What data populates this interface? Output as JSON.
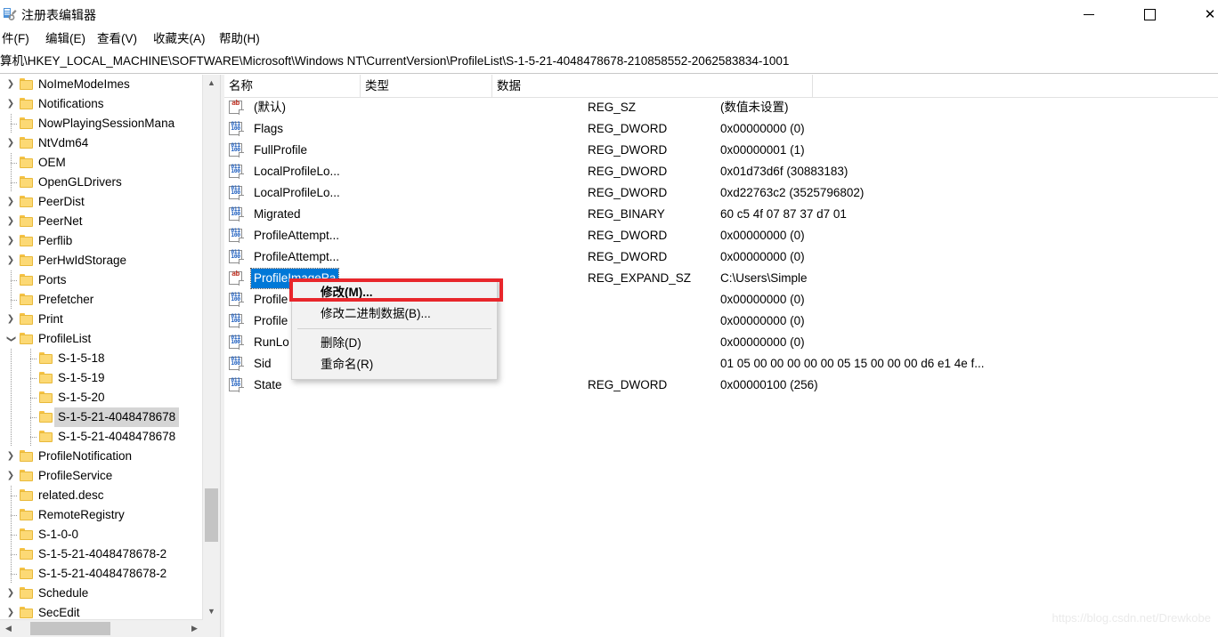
{
  "window": {
    "title": "注册表编辑器",
    "icon": "registry-editor-icon",
    "minimize_label": "—",
    "maximize_label": "□",
    "close_label": "✕"
  },
  "menubar": {
    "items": [
      {
        "label": "件(F)"
      },
      {
        "label": "编辑(E)"
      },
      {
        "label": "查看(V)"
      },
      {
        "label": "收藏夹(A)"
      },
      {
        "label": "帮助(H)"
      }
    ]
  },
  "address": {
    "path": "算机\\HKEY_LOCAL_MACHINE\\SOFTWARE\\Microsoft\\Windows NT\\CurrentVersion\\ProfileList\\S-1-5-21-4048478678-210858552-2062583834-1001"
  },
  "tree": {
    "items": [
      {
        "label": "NoImeModeImes",
        "indent": 0,
        "expander": "collapsed",
        "selected": false
      },
      {
        "label": "Notifications",
        "indent": 0,
        "expander": "collapsed",
        "selected": false
      },
      {
        "label": "NowPlayingSessionMana",
        "indent": 0,
        "expander": "leaf",
        "selected": false
      },
      {
        "label": "NtVdm64",
        "indent": 0,
        "expander": "collapsed",
        "selected": false
      },
      {
        "label": "OEM",
        "indent": 0,
        "expander": "leaf",
        "selected": false
      },
      {
        "label": "OpenGLDrivers",
        "indent": 0,
        "expander": "leaf",
        "selected": false
      },
      {
        "label": "PeerDist",
        "indent": 0,
        "expander": "collapsed",
        "selected": false
      },
      {
        "label": "PeerNet",
        "indent": 0,
        "expander": "collapsed",
        "selected": false
      },
      {
        "label": "Perflib",
        "indent": 0,
        "expander": "collapsed",
        "selected": false
      },
      {
        "label": "PerHwIdStorage",
        "indent": 0,
        "expander": "collapsed",
        "selected": false
      },
      {
        "label": "Ports",
        "indent": 0,
        "expander": "leaf",
        "selected": false
      },
      {
        "label": "Prefetcher",
        "indent": 0,
        "expander": "leaf",
        "selected": false
      },
      {
        "label": "Print",
        "indent": 0,
        "expander": "collapsed",
        "selected": false
      },
      {
        "label": "ProfileList",
        "indent": 0,
        "expander": "expanded",
        "selected": false
      },
      {
        "label": "S-1-5-18",
        "indent": 1,
        "expander": "leaf",
        "selected": false
      },
      {
        "label": "S-1-5-19",
        "indent": 1,
        "expander": "leaf",
        "selected": false
      },
      {
        "label": "S-1-5-20",
        "indent": 1,
        "expander": "leaf",
        "selected": false
      },
      {
        "label": "S-1-5-21-4048478678",
        "indent": 1,
        "expander": "leaf",
        "selected": true
      },
      {
        "label": "S-1-5-21-4048478678",
        "indent": 1,
        "expander": "leaf",
        "selected": false
      },
      {
        "label": "ProfileNotification",
        "indent": 0,
        "expander": "collapsed",
        "selected": false
      },
      {
        "label": "ProfileService",
        "indent": 0,
        "expander": "collapsed",
        "selected": false
      },
      {
        "label": "related.desc",
        "indent": 0,
        "expander": "leaf",
        "selected": false
      },
      {
        "label": "RemoteRegistry",
        "indent": 0,
        "expander": "leaf",
        "selected": false
      },
      {
        "label": "S-1-0-0",
        "indent": 0,
        "expander": "leaf",
        "selected": false
      },
      {
        "label": "S-1-5-21-4048478678-2",
        "indent": 0,
        "expander": "leaf",
        "selected": false
      },
      {
        "label": "S-1-5-21-4048478678-2",
        "indent": 0,
        "expander": "leaf",
        "selected": false
      },
      {
        "label": "Schedule",
        "indent": 0,
        "expander": "collapsed",
        "selected": false
      },
      {
        "label": "SecEdit",
        "indent": 0,
        "expander": "collapsed",
        "selected": false
      }
    ]
  },
  "list": {
    "columns": [
      {
        "label": "名称"
      },
      {
        "label": "类型"
      },
      {
        "label": "数据"
      }
    ],
    "rows": [
      {
        "name": "(默认)",
        "type": "REG_SZ",
        "data": "(数值未设置)",
        "icon": "string-value-icon",
        "selected": false
      },
      {
        "name": "Flags",
        "type": "REG_DWORD",
        "data": "0x00000000 (0)",
        "icon": "binary-value-icon",
        "selected": false
      },
      {
        "name": "FullProfile",
        "type": "REG_DWORD",
        "data": "0x00000001 (1)",
        "icon": "binary-value-icon",
        "selected": false
      },
      {
        "name": "LocalProfileLo...",
        "type": "REG_DWORD",
        "data": "0x01d73d6f (30883183)",
        "icon": "binary-value-icon",
        "selected": false
      },
      {
        "name": "LocalProfileLo...",
        "type": "REG_DWORD",
        "data": "0xd22763c2 (3525796802)",
        "icon": "binary-value-icon",
        "selected": false
      },
      {
        "name": "Migrated",
        "type": "REG_BINARY",
        "data": "60 c5 4f 07 87 37 d7 01",
        "icon": "binary-value-icon",
        "selected": false
      },
      {
        "name": "ProfileAttempt...",
        "type": "REG_DWORD",
        "data": "0x00000000 (0)",
        "icon": "binary-value-icon",
        "selected": false
      },
      {
        "name": "ProfileAttempt...",
        "type": "REG_DWORD",
        "data": "0x00000000 (0)",
        "icon": "binary-value-icon",
        "selected": false
      },
      {
        "name": "ProfileImagePa",
        "type": "REG_EXPAND_SZ",
        "data": "C:\\Users\\Simple",
        "icon": "string-value-icon",
        "selected": true
      },
      {
        "name": "Profile",
        "type": "",
        "data": "0x00000000 (0)",
        "icon": "binary-value-icon",
        "selected": false
      },
      {
        "name": "Profile",
        "type": "",
        "data": "0x00000000 (0)",
        "icon": "binary-value-icon",
        "selected": false
      },
      {
        "name": "RunLo",
        "type": "",
        "data": "0x00000000 (0)",
        "icon": "binary-value-icon",
        "selected": false
      },
      {
        "name": "Sid",
        "type": "",
        "data": "01 05 00 00 00 00 00 05 15 00 00 00 d6 e1 4e f...",
        "icon": "binary-value-icon",
        "selected": false
      },
      {
        "name": "State",
        "type": "REG_DWORD",
        "data": "0x00000100 (256)",
        "icon": "binary-value-icon",
        "selected": false
      }
    ]
  },
  "context_menu": {
    "items": [
      {
        "label": "修改(M)...",
        "bold": true,
        "separator_after": false
      },
      {
        "label": "修改二进制数据(B)...",
        "bold": false,
        "separator_after": true
      },
      {
        "label": "删除(D)",
        "bold": false,
        "separator_after": false
      },
      {
        "label": "重命名(R)",
        "bold": false,
        "separator_after": false
      }
    ],
    "highlight_color": "#e8262b"
  },
  "watermark": {
    "text": "https://blog.csdn.net/Drewkobe"
  }
}
